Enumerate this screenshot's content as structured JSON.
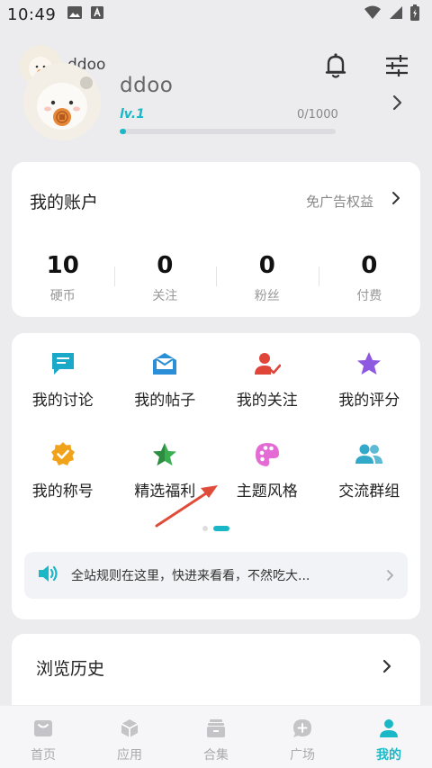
{
  "status_bar": {
    "time": "10:49"
  },
  "header": {
    "small_name": "ddoo",
    "username": "ddoo",
    "level": "lv.1",
    "level_progress": "0/1000",
    "progress_fraction": 0.03
  },
  "account": {
    "title": "我的账户",
    "adfree_label": "免广告权益",
    "stats": [
      {
        "value": "10",
        "label": "硬币"
      },
      {
        "value": "0",
        "label": "关注"
      },
      {
        "value": "0",
        "label": "粉丝"
      },
      {
        "value": "0",
        "label": "付费"
      }
    ]
  },
  "menu": {
    "items": [
      {
        "label": "我的讨论",
        "icon": "discussion-icon"
      },
      {
        "label": "我的帖子",
        "icon": "mail-icon"
      },
      {
        "label": "我的关注",
        "icon": "user-check-icon"
      },
      {
        "label": "我的评分",
        "icon": "star-icon"
      },
      {
        "label": "我的称号",
        "icon": "badge-icon"
      },
      {
        "label": "精选福利",
        "icon": "welfare-star-icon"
      },
      {
        "label": "主题风格",
        "icon": "palette-icon"
      },
      {
        "label": "交流群组",
        "icon": "group-icon"
      }
    ],
    "notice": "全站规则在这里，快进来看看，不然吃大..."
  },
  "history": {
    "title": "浏览历史"
  },
  "nav": {
    "items": [
      {
        "label": "首页",
        "active": false
      },
      {
        "label": "应用",
        "active": false
      },
      {
        "label": "合集",
        "active": false
      },
      {
        "label": "广场",
        "active": false
      },
      {
        "label": "我的",
        "active": true
      }
    ]
  },
  "colors": {
    "accent": "#1ab8c6",
    "discussion": "#1aa9c9",
    "mail": "#2a8fd6",
    "user_check": "#e0453a",
    "star": "#8e59e0",
    "badge": "#f0a21a",
    "welfare": "#3cae52",
    "palette": "#e46bd4",
    "group": "#33a9c9",
    "annotation_arrow": "#e04c3a"
  }
}
